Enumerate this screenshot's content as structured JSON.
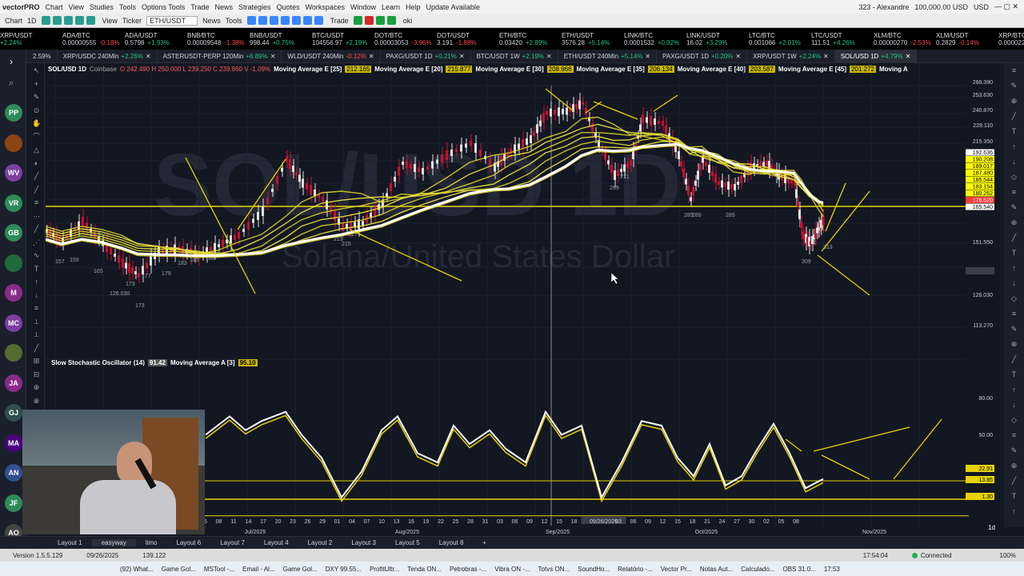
{
  "titlebar": {
    "menus": [
      "Chart",
      "View",
      "Studies",
      "Tools",
      "Options Tools",
      "Trade",
      "News",
      "Strategies",
      "Quotes",
      "Workspaces",
      "Window",
      "Learn",
      "Help",
      "Update Available"
    ],
    "app": "vectorPRO",
    "user": "323 - Alexandre",
    "balance": "100,000.00 USD",
    "currency": "USD"
  },
  "toolbar": {
    "chart": "Chart",
    "interval": "1D",
    "view": "View",
    "ticker_label": "Ticker",
    "ticker": "ETH/USDT",
    "news": "News",
    "tools": "Tools",
    "trade": "Trade",
    "oki": "oki"
  },
  "tickers": [
    {
      "name": "XRP/USDT",
      "a": "+2.24%"
    },
    {
      "name": "ADA/BTC",
      "a": "0.00000555",
      "b": "-0.18%"
    },
    {
      "name": "ADA/USDT",
      "a": "0.5798",
      "b": "+1.93%"
    },
    {
      "name": "BNB/BTC",
      "a": "0.00009548",
      "b": "-1.38%"
    },
    {
      "name": "BNB/USDT",
      "a": "998.44",
      "b": "+0.75%"
    },
    {
      "name": "BTC/USDT",
      "a": "104556.97",
      "b": "+2.19%"
    },
    {
      "name": "DOT/BTC",
      "a": "0.00003053",
      "b": "-3.96%"
    },
    {
      "name": "DOT/USDT",
      "a": "3.191",
      "b": "-1.88%"
    },
    {
      "name": "ETH/BTC",
      "a": "0.03420",
      "b": "+2.89%"
    },
    {
      "name": "ETH/USDT",
      "a": "3576.28",
      "b": "+5.14%"
    },
    {
      "name": "LINK/BTC",
      "a": "0.0001532",
      "b": "+0.92%"
    },
    {
      "name": "LINK/USDT",
      "a": "16.02",
      "b": "+3.29%"
    },
    {
      "name": "LTC/BTC",
      "a": "0.001066",
      "b": "+2.01%"
    },
    {
      "name": "LTC/USDT",
      "a": "111.51",
      "b": "+4.26%"
    },
    {
      "name": "XLM/BTC",
      "a": "0.00000270",
      "b": "-2.53%"
    },
    {
      "name": "XLM/USDT",
      "a": "0.2829",
      "b": "-0.14%"
    },
    {
      "name": "XRP/BTC",
      "a": "0.00002238",
      "b": "+0.13%"
    },
    {
      "name": "XRP/USDT",
      "a": "2.2543",
      "b": "+2.24%"
    }
  ],
  "tabs": [
    {
      "label": "2.59%"
    },
    {
      "label": "XRP/USDC 240Min",
      "chg": "+2.26%"
    },
    {
      "label": "ASTERUSDT-PERP 120Min",
      "chg": "+6.89%"
    },
    {
      "label": "WLD/USDT 240Min",
      "chg": "-0.12%"
    },
    {
      "label": "PAXG/USDT 1D",
      "chg": "+0.21%"
    },
    {
      "label": "BTC/USDT 1W",
      "chg": "+2.19%"
    },
    {
      "label": "ETH/USDT 240Min",
      "chg": "+5.14%"
    },
    {
      "label": "PAXG/USDT 1D",
      "chg": "+0.20%"
    },
    {
      "label": "XRP/USDT 1W",
      "chg": "+2.24%"
    },
    {
      "label": "SOL/USD 1D",
      "chg": "+4.79%"
    }
  ],
  "avatars": [
    "PP",
    "",
    "WV",
    "VR",
    "GB",
    "",
    "M",
    "MC",
    "",
    "JA",
    "GJ",
    "MA",
    "AN",
    "JF",
    "AO"
  ],
  "legend": {
    "symbol": "SOL/USD 1D",
    "exchange": "Coinbase",
    "ohlc": "O 242.490 H 250.000 L 239.250 C 239.860 V -1.09%",
    "mas": [
      {
        "label": "Moving Average E [25]",
        "value": "212.165"
      },
      {
        "label": "Moving Average E [20]",
        "value": "215.877"
      },
      {
        "label": "Moving Average E [30]",
        "value": "208.966"
      },
      {
        "label": "Moving Average E [35]",
        "value": "206.134"
      },
      {
        "label": "Moving Average E [40]",
        "value": "203.587"
      },
      {
        "label": "Moving Average E [45]",
        "value": "201.272"
      },
      {
        "label": "Moving A",
        "value": ""
      }
    ]
  },
  "watermark": {
    "big": "SOL/USD 1D",
    "sub": "Solana/United States Dollar"
  },
  "price_axis": [
    "266.390",
    "253.630",
    "240.870",
    "228.110",
    "215.350",
    "202.590",
    "151.550",
    "137.831",
    "126.030",
    "113.270"
  ],
  "price_labels": [
    {
      "v": "192.636",
      "c": "#ffffff"
    },
    {
      "v": "190.208",
      "c": "#ffff00"
    },
    {
      "v": "189.017",
      "c": "#ffff00"
    },
    {
      "v": "187.480",
      "c": "#ffff00"
    },
    {
      "v": "185.544",
      "c": "#ffff00"
    },
    {
      "v": "183.154",
      "c": "#ffff00"
    },
    {
      "v": "180.262",
      "c": "#ffff00"
    },
    {
      "v": "176.520",
      "c": "#ff3b3b"
    },
    {
      "v": "165.540",
      "c": "#ffffff"
    }
  ],
  "candle_labels": [
    "157",
    "159",
    "165",
    "173",
    "179",
    "177",
    "183",
    "185",
    "188",
    "126.030",
    "173",
    "213",
    "215",
    "217",
    "285",
    "289",
    "269",
    "271",
    "285",
    "309",
    "313"
  ],
  "stoch": {
    "title": "Slow Stochastic Oscillator (14)",
    "value": "91.42",
    "ma": "Moving Average A [3]",
    "ma_value": "95.10",
    "axis": [
      "80.00",
      "50.00",
      "1.30"
    ],
    "k": "22.91",
    "d": "13.85"
  },
  "time_axis": {
    "days": [
      "15",
      "08",
      "11",
      "14",
      "17",
      "20",
      "23",
      "26",
      "29",
      "01",
      "04",
      "07",
      "10",
      "13",
      "16",
      "19",
      "22",
      "25",
      "28",
      "31",
      "03",
      "06",
      "09",
      "12",
      "15",
      "18",
      "21",
      "09/26/2025",
      "03",
      "06",
      "09",
      "12",
      "15",
      "18",
      "21",
      "24",
      "27",
      "30",
      "02",
      "05",
      "08"
    ],
    "months": [
      "Jul/2025",
      "Aug/2025",
      "Sep/2025",
      "Oct/2025",
      "Nov/2025"
    ],
    "interval": "1d"
  },
  "layouts": [
    "Layout 1",
    "easyway",
    "limo",
    "Layout 6",
    "Layout 7",
    "Layout 4",
    "Layout 2",
    "Layout 3",
    "Layout 5",
    "Layout 8"
  ],
  "status": {
    "version": "Version 1.5.5.129",
    "date": "09/26/2025",
    "value": "139.122",
    "time": "17:54:04",
    "connection": "Connected",
    "zoom": "100%"
  },
  "taskbar": [
    "(92) What...",
    "Game Gol...",
    "MSTool -...",
    "Email - Al...",
    "Game Gol...",
    "DXY 99.55...",
    "ProfitUltr...",
    "Tenda ON...",
    "Petrobras -...",
    "Vibra ON -...",
    "Totvs ON...",
    "SoundHo...",
    "Relatório -...",
    "Vector Pr...",
    "Notas Aut...",
    "Calculado...",
    "OBS 31.0...",
    "17:53"
  ]
}
